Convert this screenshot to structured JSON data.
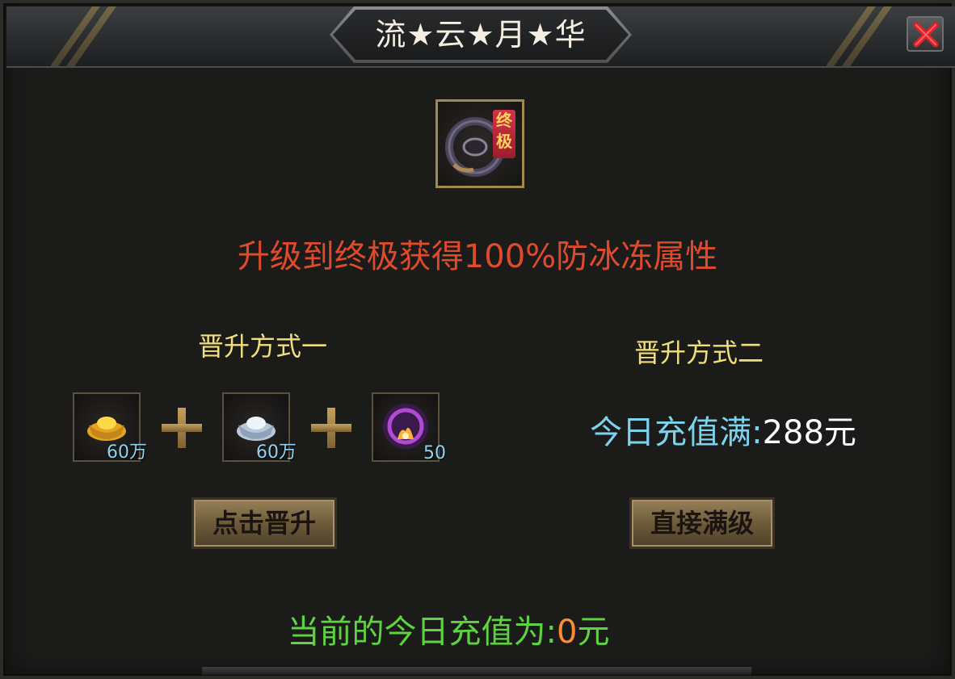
{
  "window": {
    "title": "流★云★月★华"
  },
  "item": {
    "tag_line1": "终",
    "tag_line2": "极",
    "icon": "dark-ring-weapon-icon"
  },
  "description": "升级到终极获得100%防冰冻属性",
  "method_one": {
    "title": "晋升方式一",
    "materials": [
      {
        "icon": "gold-ingot-icon",
        "count": "60万"
      },
      {
        "icon": "silver-ingot-icon",
        "count": "60万"
      },
      {
        "icon": "purple-fire-orb-icon",
        "count": "50"
      }
    ],
    "button_label": "点击晋升"
  },
  "method_two": {
    "title": "晋升方式二",
    "recharge_label": "今日充值满:",
    "recharge_amount": "288元",
    "button_label": "直接满级"
  },
  "current": {
    "label": "当前的今日充值为:",
    "value": "0",
    "unit": "元"
  },
  "colors": {
    "title_text": "#f4efe2",
    "description": "#e04a2c",
    "method_title": "#f1de7c",
    "recharge_label": "#7dd2ee",
    "current_label": "#5ed342",
    "current_value": "#ff8c33"
  }
}
